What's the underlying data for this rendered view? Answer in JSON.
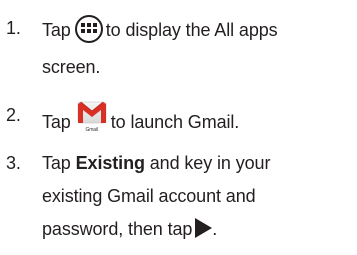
{
  "steps": [
    {
      "number": "1.",
      "before_icon": "Tap",
      "icon": "all-apps-icon",
      "after_icon": "to display the All apps",
      "continuation": "screen."
    },
    {
      "number": "2.",
      "before_icon": "Tap",
      "icon": "gmail-icon",
      "icon_caption": "Gmail",
      "after_icon": "to launch Gmail."
    },
    {
      "number": "3.",
      "before_bold": "Tap",
      "bold": "Existing",
      "after_bold": "and key in your",
      "line2": "existing Gmail account and",
      "line3_before_icon": "password, then tap",
      "line3_icon": "forward-arrow-icon",
      "line3_after_icon": "."
    }
  ],
  "colors": {
    "text": "#231f20",
    "gmail_red": "#d93025"
  }
}
